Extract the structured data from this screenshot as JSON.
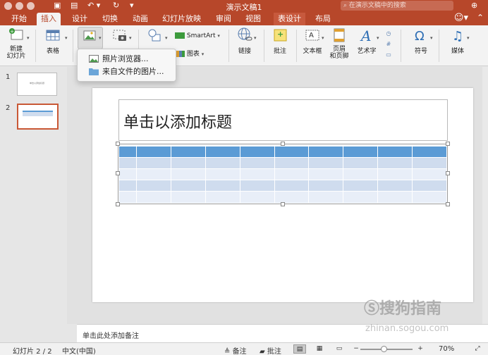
{
  "window": {
    "title": "演示文稿1"
  },
  "search": {
    "placeholder": "在演示文稿中的搜索"
  },
  "tabs": [
    {
      "label": "开始"
    },
    {
      "label": "插入"
    },
    {
      "label": "设计"
    },
    {
      "label": "切换"
    },
    {
      "label": "动画"
    },
    {
      "label": "幻灯片放映"
    },
    {
      "label": "审阅"
    },
    {
      "label": "视图"
    },
    {
      "label": "表设计"
    },
    {
      "label": "布局"
    }
  ],
  "ribbon": {
    "new_slide": "新建\n幻灯片",
    "table": "表格",
    "smartart": "SmartArt",
    "chart": "图表",
    "link": "链接",
    "comment": "批注",
    "textbox": "文本框",
    "header_footer": "页眉\n和页脚",
    "wordart": "艺术字",
    "symbol": "符号",
    "media": "媒体"
  },
  "picture_menu": {
    "items": [
      {
        "label": "照片浏览器...",
        "icon": "photo-browser-icon"
      },
      {
        "label": "来自文件的图片...",
        "icon": "folder-icon"
      }
    ]
  },
  "thumbnails": [
    {
      "num": "1",
      "caption": "单击以添加标题"
    },
    {
      "num": "2"
    }
  ],
  "slide": {
    "title_placeholder": "单击以添加标题"
  },
  "table": {
    "rows": 5,
    "cols": 10,
    "header_color": "#5b9bd5",
    "band_dark": "#cfdcee",
    "band_light": "#e8eef8"
  },
  "notes": {
    "placeholder": "单击此处添加备注"
  },
  "status": {
    "slide_count": "幻灯片 2 / 2",
    "language": "中文(中国)",
    "notes_label": "备注",
    "comments_label": "批注",
    "zoom": "70%"
  },
  "watermark": {
    "text": "搜狗指南",
    "sub": "zhinan.sogou.com"
  },
  "colors": {
    "accent": "#b7472a"
  }
}
